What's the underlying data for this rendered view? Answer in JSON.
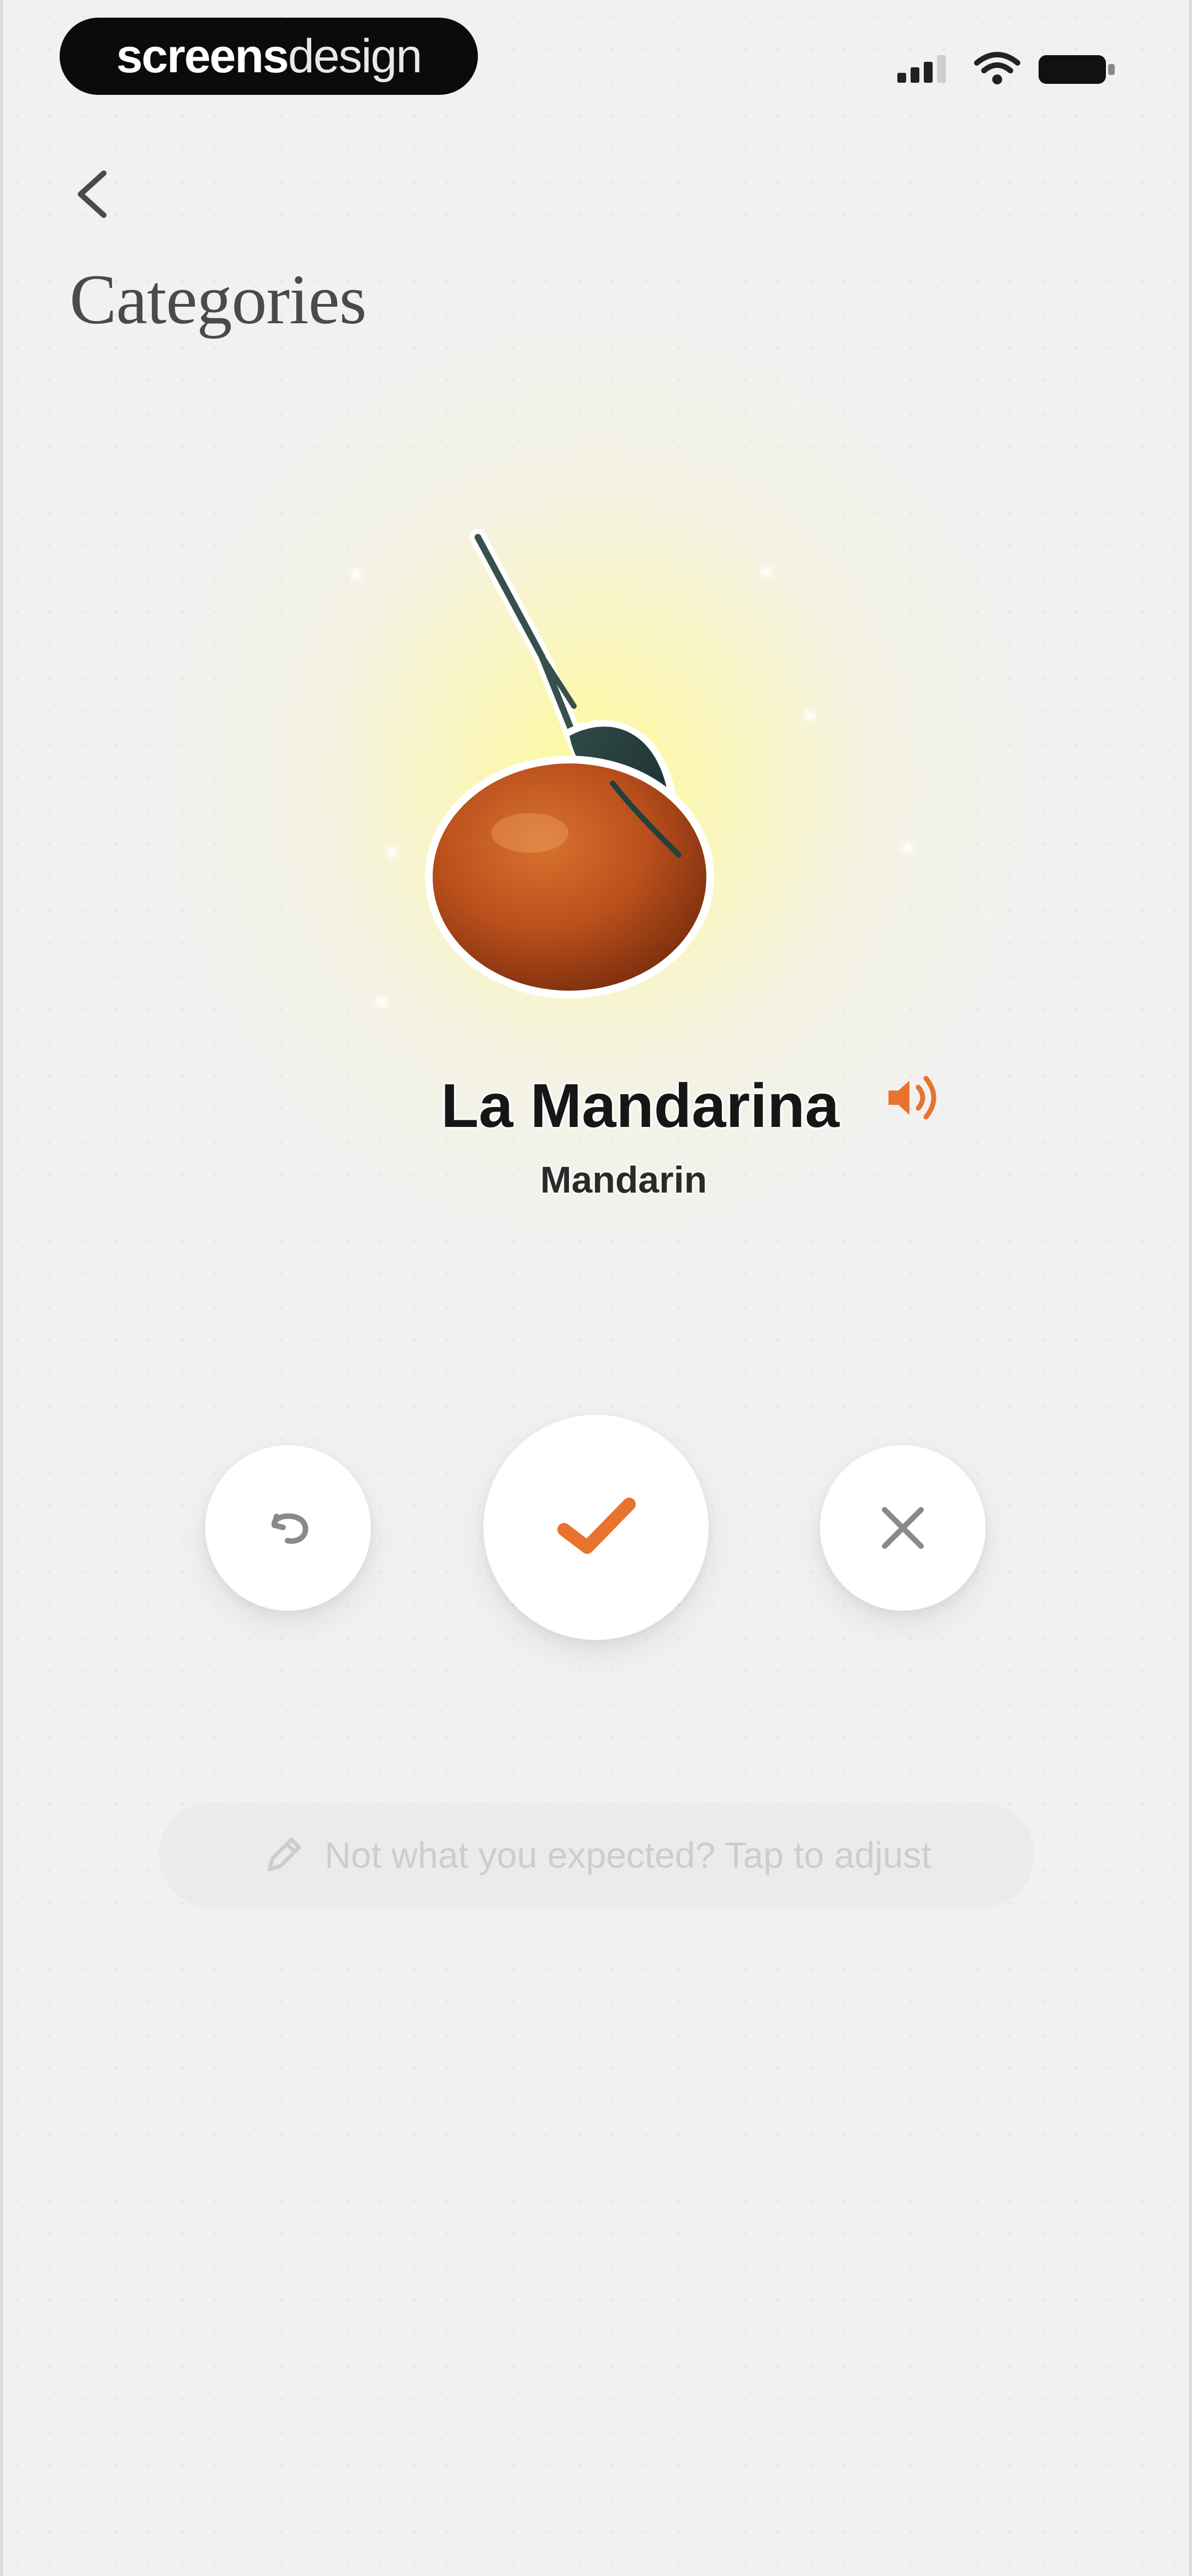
{
  "status_bar": {
    "brand_bold": "screens",
    "brand_light": "design",
    "icons": [
      "signal-icon",
      "wifi-icon",
      "battery-icon"
    ]
  },
  "header": {
    "back_icon": "chevron-left-icon",
    "title": "Categories"
  },
  "card": {
    "image": "mandarin-fruit",
    "word": "La Mandarina",
    "translation": "Mandarin",
    "audio_icon": "speaker-icon"
  },
  "actions": {
    "retry_icon": "redo-icon",
    "confirm_icon": "check-icon",
    "dismiss_icon": "close-icon"
  },
  "adjust": {
    "icon": "pencil-icon",
    "label": "Not what you expected? Tap to adjust"
  },
  "colors": {
    "background": "#f1f1f1",
    "accent": "#e8732e",
    "title": "#4a4a4a",
    "glow": "#fff9a0"
  }
}
